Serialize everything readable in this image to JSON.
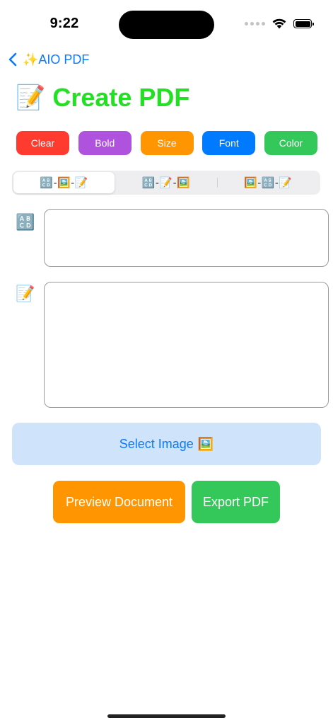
{
  "status_bar": {
    "time": "9:22",
    "icons": [
      "signal-dots-icon",
      "wifi-icon",
      "battery-icon"
    ]
  },
  "nav": {
    "back_label": "✨AIO PDF",
    "back_icon": "chevron-left-icon"
  },
  "header": {
    "title_emoji": "📝",
    "title": "Create PDF",
    "title_color": "#24e024"
  },
  "toolbar": {
    "buttons": [
      {
        "label": "Clear",
        "color": "#ff3b30"
      },
      {
        "label": "Bold",
        "color": "#af52de"
      },
      {
        "label": "Size",
        "color": "#ff9500"
      },
      {
        "label": "Font",
        "color": "#007aff"
      },
      {
        "label": "Color",
        "color": "#34c759"
      }
    ]
  },
  "layout_picker": {
    "options": [
      "🔠-🖼️-📝",
      "🔠-📝-🖼️",
      "🖼️-🔠-📝"
    ],
    "selected_index": 0
  },
  "fields": {
    "title_icon": "🔠",
    "title_value": "",
    "body_icon": "📝",
    "body_value": ""
  },
  "select_image": {
    "label": "Select Image",
    "emoji": "🖼️",
    "color": "#cfe3fb"
  },
  "actions": {
    "preview_label": "Preview Document",
    "preview_color": "#ff9500",
    "export_label": "Export PDF",
    "export_color": "#34c759"
  }
}
